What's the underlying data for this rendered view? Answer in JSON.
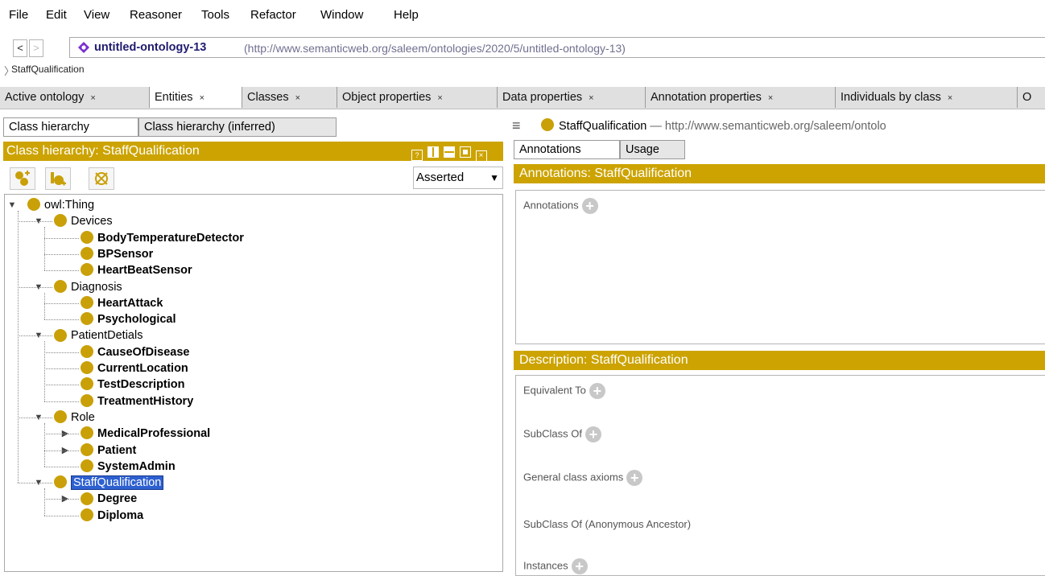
{
  "menu": [
    "File",
    "Edit",
    "View",
    "Reasoner",
    "Tools",
    "Refactor",
    "Window",
    "Help"
  ],
  "address": {
    "back": "<",
    "forward": ">",
    "ontology_name": "untitled-ontology-13",
    "ontology_iri": "(http://www.semanticweb.org/saleem/ontologies/2020/5/untitled-ontology-13)",
    "breadcrumb": "StaffQualification"
  },
  "tabs": [
    "Active ontology",
    "Entities",
    "Classes",
    "Object properties",
    "Data properties",
    "Annotation properties",
    "Individuals by class",
    "O"
  ],
  "active_tab": "Entities",
  "left": {
    "subtabs": [
      "Class hierarchy",
      "Class hierarchy (inferred)"
    ],
    "header": "Class hierarchy: StaffQualification",
    "mode": "Asserted",
    "tree": [
      {
        "label": "owl:Thing",
        "level": 0,
        "expander": "open",
        "bold": false
      },
      {
        "label": "Devices",
        "level": 1,
        "expander": "open",
        "bold": false
      },
      {
        "label": "BodyTemperatureDetector",
        "level": 2,
        "expander": "none",
        "bold": true
      },
      {
        "label": "BPSensor",
        "level": 2,
        "expander": "none",
        "bold": true
      },
      {
        "label": "HeartBeatSensor",
        "level": 2,
        "expander": "none",
        "bold": true
      },
      {
        "label": "Diagnosis",
        "level": 1,
        "expander": "open",
        "bold": false
      },
      {
        "label": "HeartAttack",
        "level": 2,
        "expander": "none",
        "bold": true
      },
      {
        "label": "Psychological",
        "level": 2,
        "expander": "none",
        "bold": true
      },
      {
        "label": "PatientDetials",
        "level": 1,
        "expander": "open",
        "bold": false
      },
      {
        "label": "CauseOfDisease",
        "level": 2,
        "expander": "none",
        "bold": true
      },
      {
        "label": "CurrentLocation",
        "level": 2,
        "expander": "none",
        "bold": true
      },
      {
        "label": "TestDescription",
        "level": 2,
        "expander": "none",
        "bold": true
      },
      {
        "label": "TreatmentHistory",
        "level": 2,
        "expander": "none",
        "bold": true
      },
      {
        "label": "Role",
        "level": 1,
        "expander": "open",
        "bold": false
      },
      {
        "label": "MedicalProfessional",
        "level": 2,
        "expander": "closed",
        "bold": true
      },
      {
        "label": "Patient",
        "level": 2,
        "expander": "closed",
        "bold": true
      },
      {
        "label": "SystemAdmin",
        "level": 2,
        "expander": "none",
        "bold": true
      },
      {
        "label": "StaffQualification",
        "level": 1,
        "expander": "open",
        "bold": false,
        "selected": true
      },
      {
        "label": "Degree",
        "level": 2,
        "expander": "closed",
        "bold": true
      },
      {
        "label": "Diploma",
        "level": 2,
        "expander": "none",
        "bold": true
      }
    ]
  },
  "right": {
    "entity": "StaffQualification",
    "entity_iri": "— http://www.semanticweb.org/saleem/ontolo",
    "subtabs": [
      "Annotations",
      "Usage"
    ],
    "annotations_header": "Annotations: StaffQualification",
    "annotations_label": "Annotations",
    "description_header": "Description: StaffQualification",
    "sections": [
      "Equivalent To",
      "SubClass Of",
      "General class axioms",
      "SubClass Of (Anonymous Ancestor)",
      "Instances"
    ]
  },
  "colors": {
    "gold": "#cca300",
    "class_dot": "#c9a008",
    "selection": "#2d60d0"
  }
}
